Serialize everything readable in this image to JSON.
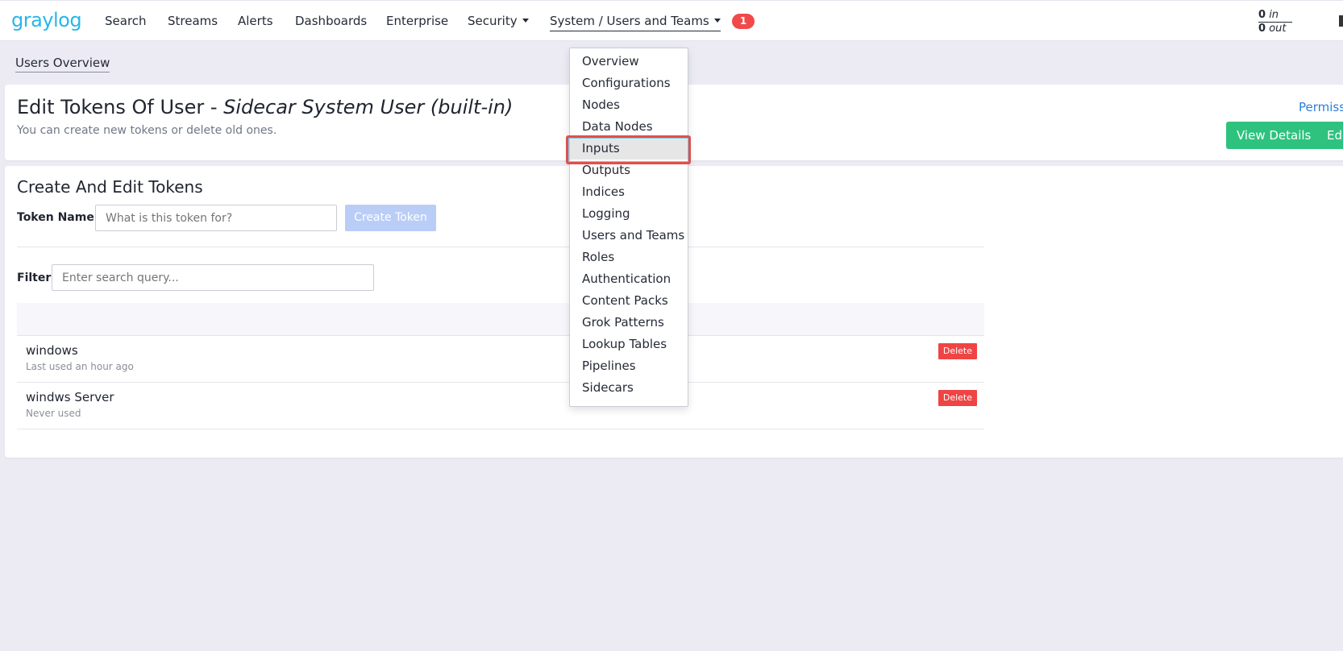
{
  "nav": {
    "logo": "graylog",
    "items": [
      {
        "label": "Search"
      },
      {
        "label": "Streams"
      },
      {
        "label": "Alerts"
      },
      {
        "label": "Dashboards"
      },
      {
        "label": "Enterprise"
      },
      {
        "label": "Security"
      },
      {
        "label": "System / Users and Teams"
      }
    ],
    "notification_count": "1",
    "throughput": {
      "in_value": "0",
      "in_label": "in",
      "out_value": "0",
      "out_label": "out"
    }
  },
  "breadcrumb": "Users Overview",
  "header": {
    "title_prefix": "Edit Tokens Of User - ",
    "title_user": "Sidecar System User (built-in)",
    "description": "You can create new tokens or delete old ones.",
    "permissions_link": "Permissi",
    "view_details_label": "View Details",
    "edit_label": "Edi"
  },
  "tokens": {
    "section_title": "Create And Edit Tokens",
    "token_name_label": "Token Name",
    "token_name_placeholder": "What is this token for?",
    "create_button": "Create Token",
    "filter_label": "Filter",
    "filter_placeholder": "Enter search query...",
    "rows": [
      {
        "name": "windows",
        "last_used": "Last used an hour ago",
        "delete_label": "Delete"
      },
      {
        "name": "windws Server",
        "last_used": "Never used",
        "delete_label": "Delete"
      }
    ]
  },
  "system_menu": {
    "items": [
      {
        "label": "Overview"
      },
      {
        "label": "Configurations"
      },
      {
        "label": "Nodes"
      },
      {
        "label": "Data Nodes"
      },
      {
        "label": "Inputs"
      },
      {
        "label": "Outputs"
      },
      {
        "label": "Indices"
      },
      {
        "label": "Logging"
      },
      {
        "label": "Users and Teams"
      },
      {
        "label": "Roles"
      },
      {
        "label": "Authentication"
      },
      {
        "label": "Content Packs"
      },
      {
        "label": "Grok Patterns"
      },
      {
        "label": "Lookup Tables"
      },
      {
        "label": "Pipelines"
      },
      {
        "label": "Sidecars"
      }
    ],
    "highlighted": "Inputs"
  },
  "colors": {
    "brand": "#27b7e8",
    "accent_green": "#2ec27e",
    "danger": "#ef4444",
    "link": "#2f7dd8"
  }
}
